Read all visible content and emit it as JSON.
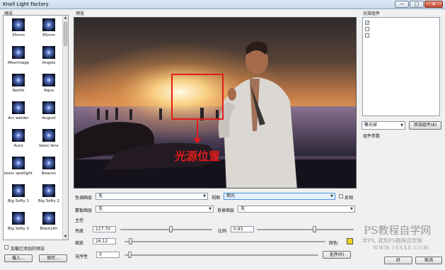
{
  "window": {
    "title": "Knoll Light Factory",
    "min_glyph": "─",
    "max_glyph": "□",
    "close_glyph": "✕"
  },
  "presets_panel": {
    "label": "预设",
    "items": [
      {
        "name": "35mm"
      },
      {
        "name": "85mm"
      },
      {
        "name": "Afterimage"
      },
      {
        "name": "Angels"
      },
      {
        "name": "Apollo"
      },
      {
        "name": "Aqua"
      },
      {
        "name": "Arc welder"
      },
      {
        "name": "August"
      },
      {
        "name": "Aura"
      },
      {
        "name": "basic lens"
      },
      {
        "name": "basic spotlight"
      },
      {
        "name": "Beacon"
      },
      {
        "name": "Big Softy 1"
      },
      {
        "name": "Big Softy 2"
      },
      {
        "name": "Big Softy 3"
      },
      {
        "name": "BlackLlth"
      }
    ],
    "add_checkbox_label": "加载已添加的预设",
    "load_button": "载入...",
    "save_button": "保存..."
  },
  "preview": {
    "label": "预览",
    "annotation_text": "光源位置"
  },
  "controls": {
    "color_layer_label": "色调图层",
    "color_layer_value": "无",
    "view_label": "视图",
    "view_value": "观光",
    "invert_label": "反相",
    "mask_layer_label": "蒙板图层",
    "mask_layer_value": "无",
    "background_layer_label": "背景图层",
    "background_layer_value": "无",
    "master_label": "主控",
    "brightness_label": "亮度",
    "brightness_value": "117.70",
    "brightness_level": 0.55,
    "scale_label": "比例",
    "scale_value": "0.93",
    "scale_level": 0.6,
    "zoom_label": "缩放",
    "zoom_value": "16.12",
    "zoom_level": 0.02,
    "color_label": "颜色:",
    "color_value": "#f2d21a",
    "randomness_label": "无序性",
    "randomness_value": "0",
    "randomness_level": 0.02,
    "random_button": "无序(R)"
  },
  "components_panel": {
    "label": "光效组件",
    "rows": [
      {
        "checked": true
      },
      {
        "checked": false
      },
      {
        "checked": false
      }
    ],
    "component_select_value": "聚光球",
    "add_component_button": "添加组件(A)",
    "params_label": "组件参数"
  },
  "dialog_buttons": {
    "ok": "好",
    "cancel": "取消"
  },
  "watermark": {
    "line1": "PS教程自学网",
    "line2": "学PS, 就到PS教程自学网",
    "line3": "WWW.16XX8.COM"
  }
}
